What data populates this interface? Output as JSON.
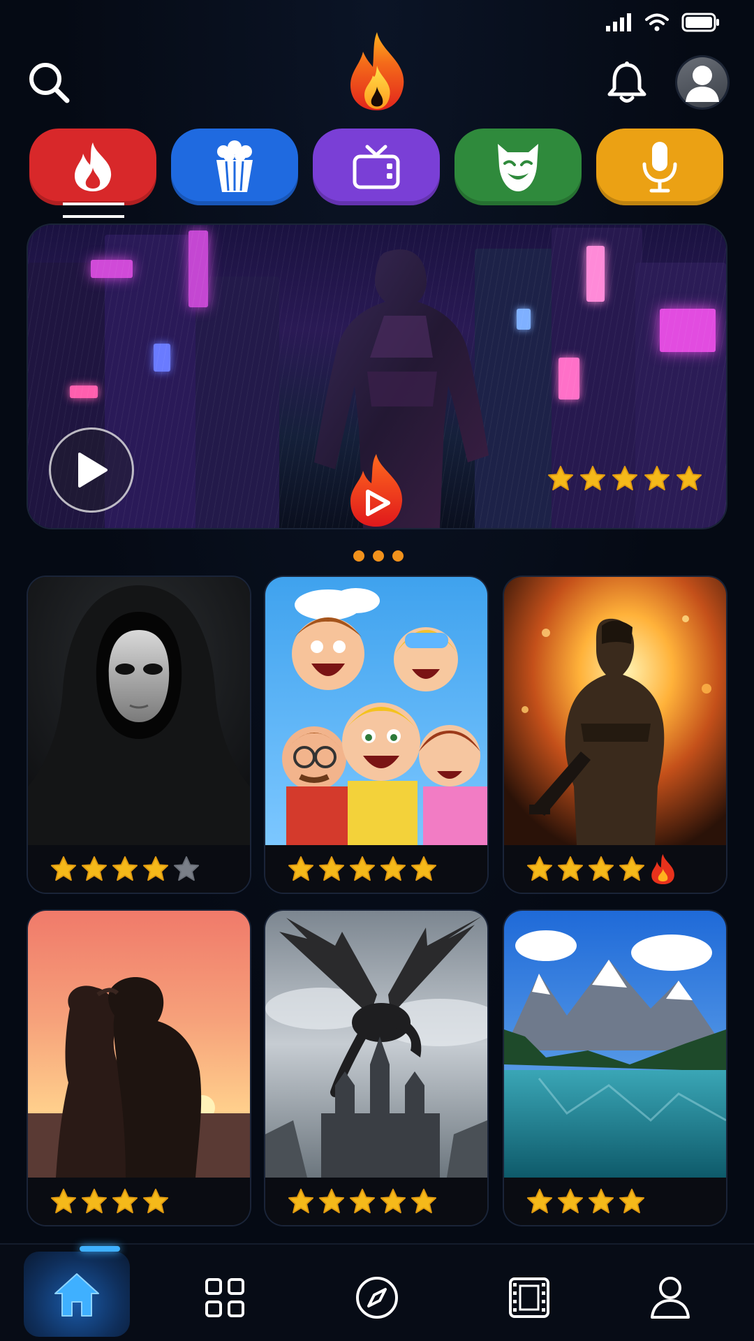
{
  "colors": {
    "background": "#050a14",
    "accent_orange": "#f2921c",
    "star_gold": "#f5b91a",
    "cat_trending": "#d8282a",
    "cat_movies": "#1f6ae0",
    "cat_tv": "#7a3fd6",
    "cat_kids": "#2f8a3c",
    "cat_podcasts": "#eba114",
    "nav_active": "#3fb0ff"
  },
  "header": {
    "search_icon": "search-icon",
    "logo_icon": "flame-logo-icon",
    "notification_icon": "bell-icon",
    "avatar_icon": "user-avatar-icon"
  },
  "categories": [
    {
      "icon": "flame-icon",
      "active": true
    },
    {
      "icon": "popcorn-icon",
      "active": false
    },
    {
      "icon": "tv-icon",
      "active": false
    },
    {
      "icon": "theater-mask-icon",
      "active": false
    },
    {
      "icon": "microphone-icon",
      "active": false
    }
  ],
  "hero": {
    "rating_stars": 5,
    "play_icon": "play-icon",
    "badge_icon": "flame-play-badge-icon",
    "carousel_dots": 3
  },
  "cards": [
    {
      "theme": "horror",
      "rating": 4,
      "max": 5,
      "extra_icon": ""
    },
    {
      "theme": "animation",
      "rating": 5,
      "max": 5,
      "extra_icon": ""
    },
    {
      "theme": "action",
      "rating": 4,
      "max": 4,
      "extra_icon": "flame-icon"
    },
    {
      "theme": "romance",
      "rating": 4,
      "max": 4,
      "extra_icon": ""
    },
    {
      "theme": "fantasy",
      "rating": 5,
      "max": 5,
      "extra_icon": ""
    },
    {
      "theme": "nature",
      "rating": 4,
      "max": 4,
      "extra_icon": ""
    }
  ],
  "nav": {
    "items": [
      {
        "icon": "home-icon",
        "active": true
      },
      {
        "icon": "grid-icon",
        "active": false
      },
      {
        "icon": "compass-icon",
        "active": false
      },
      {
        "icon": "film-icon",
        "active": false
      },
      {
        "icon": "profile-icon",
        "active": false
      }
    ]
  }
}
